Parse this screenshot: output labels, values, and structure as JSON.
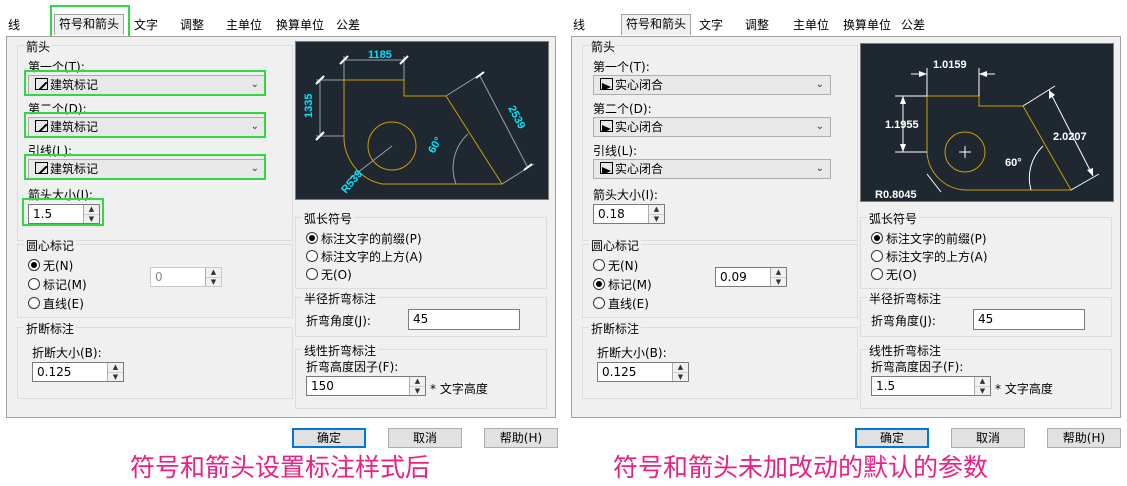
{
  "tabs": [
    "线",
    "符号和箭头",
    "文字",
    "调整",
    "主单位",
    "换算单位",
    "公差"
  ],
  "active_tab": "符号和箭头",
  "labels": {
    "arrow_group": "箭头",
    "first": "第一个(T):",
    "second": "第二个(D):",
    "leader": "引线(L):",
    "arrow_size": "箭头大小(I):",
    "center_group": "圆心标记",
    "center_none": "无(N)",
    "center_mark": "标记(M)",
    "center_line": "直线(E)",
    "break_group": "折断标注",
    "break_size": "折断大小(B):",
    "arc_group": "弧长符号",
    "arc_prefix": "标注文字的前缀(P)",
    "arc_above": "标注文字的上方(A)",
    "arc_none": "无(O)",
    "radius_group": "半径折弯标注",
    "jog_angle": "折弯角度(J):",
    "linear_group": "线性折弯标注",
    "jog_height": "折弯高度因子(F):",
    "text_height": "* 文字高度",
    "ok": "确定",
    "cancel": "取消",
    "help": "帮助(H)"
  },
  "left": {
    "first_arrow": "建筑标记",
    "second_arrow": "建筑标记",
    "leader_arrow": "建筑标记",
    "arrow_size": "1.5",
    "center_mark_value": "0",
    "center_selected": "none",
    "break_size": "0.125",
    "arc_selected": "prefix",
    "jog_angle": "45",
    "jog_height": "150",
    "preview": {
      "dim_top": "1185",
      "dim_left": "1335",
      "dim_diag": "2539",
      "angle": "60°",
      "radius": "R539"
    },
    "caption": "符号和箭头设置标注样式后"
  },
  "right": {
    "first_arrow": "实心闭合",
    "second_arrow": "实心闭合",
    "leader_arrow": "实心闭合",
    "arrow_size": "0.18",
    "center_mark_value": "0.09",
    "center_selected": "mark",
    "break_size": "0.125",
    "arc_selected": "prefix",
    "jog_angle": "45",
    "jog_height": "1.5",
    "preview": {
      "dim_top": "1.0159",
      "dim_left": "1.1955",
      "dim_diag": "2.0207",
      "angle": "60°",
      "radius": "R0.8045"
    },
    "caption": "符号和箭头未加改动的默认的参数"
  },
  "colors": {
    "highlight": "#31d843",
    "caption": "#ec1f85",
    "preview_bg": "#1f2730",
    "shape_line": "#c8a000",
    "dim_left_panel": "#00e5ff",
    "dim_right_panel": "#ffffff"
  }
}
